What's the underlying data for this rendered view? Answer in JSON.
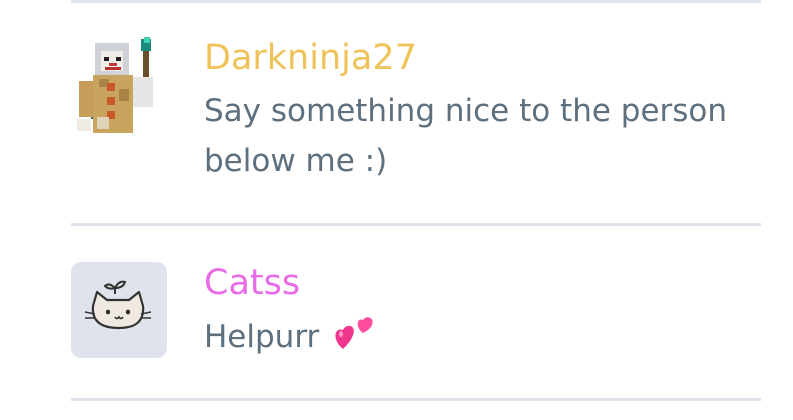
{
  "comments": [
    {
      "username": "Darkninja27",
      "username_color": "#f0c25a",
      "avatar_icon": "pixel-clown-character",
      "message_line1": "Say something nice to the person",
      "message_line2": "below me :)"
    },
    {
      "username": "Catss",
      "username_color": "#e86be8",
      "avatar_icon": "cat-face",
      "message": "Helpurr",
      "emoji": "two-hearts"
    }
  ],
  "colors": {
    "divider": "#dde3e9",
    "message_text": "#5e6f7e",
    "avatar_bg": "#dfe4ec"
  }
}
